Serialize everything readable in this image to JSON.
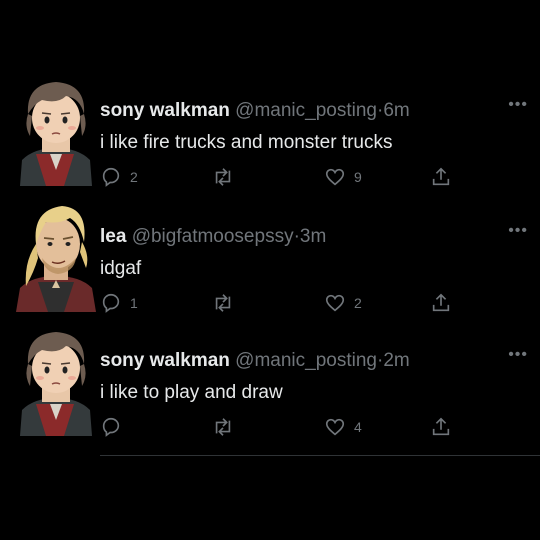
{
  "tweets": [
    {
      "name": "sony walkman",
      "handle": "@manic_posting",
      "dot": "·",
      "time": "6m",
      "text": "i like fire trucks and monster trucks",
      "replies": "2",
      "retweets": "",
      "likes": "9",
      "avatar": "brown-haired-boy-avatar"
    },
    {
      "name": "lea",
      "handle": "@bigfatmoosepssy",
      "dot": "·",
      "time": "3m",
      "text": "idgaf",
      "replies": "1",
      "retweets": "",
      "likes": "2",
      "avatar": "blond-bearded-man-avatar"
    },
    {
      "name": "sony walkman",
      "handle": "@manic_posting",
      "dot": "·",
      "time": "2m",
      "text": "i like to play and draw",
      "replies": "",
      "retweets": "",
      "likes": "4",
      "avatar": "brown-haired-boy-avatar"
    }
  ],
  "more_label": "•••",
  "colors": {
    "background": "#000000",
    "text": "#e7e9ea",
    "muted": "#71767b"
  }
}
